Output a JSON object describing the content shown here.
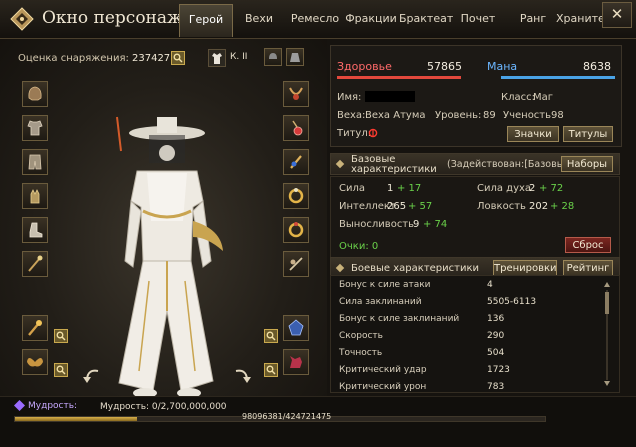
{
  "window": {
    "title": "Окно персонажа",
    "close_glyph": "✕"
  },
  "tabs": [
    {
      "label": "Герой",
      "active": true
    },
    {
      "label": "Вехи",
      "active": false
    },
    {
      "label": "Ремесло",
      "active": false
    },
    {
      "label": "Фракции",
      "active": false
    },
    {
      "label": "Брактеат",
      "active": false
    },
    {
      "label": "Почет",
      "active": false
    },
    {
      "label": "Ранг",
      "active": false
    },
    {
      "label": "Хранители",
      "active": false
    }
  ],
  "gear": {
    "label": "Оценка снаряжения:",
    "value": "237427",
    "rank_label": "К. II"
  },
  "equipment": {
    "left_slots": [
      "helmet-icon",
      "chest-armor-icon",
      "pants-icon",
      "gloves-icon",
      "boots-icon",
      "weapon-icon"
    ],
    "right_slots": [
      "necklace-icon",
      "earring-icon",
      "earring-icon",
      "ring-icon",
      "ring-icon",
      "bracelet-icon"
    ],
    "bottom_left_slots": [
      "staff-icon",
      "wings-icon"
    ],
    "bottom_right_slots": [
      "crest-icon",
      "pet-icon"
    ]
  },
  "stats": {
    "hp_label": "Здоровье",
    "hp_value": "57865",
    "mp_label": "Мана",
    "mp_value": "8638",
    "name_label": "Имя:",
    "class_label": "Класс:",
    "class_value": "Маг",
    "milestone_label": "Веха:",
    "milestone_value": "Веха Атума",
    "level_label": "Уровень:",
    "level_value": "89",
    "learning_label": "Ученость",
    "learning_value": "98",
    "title_label": "Титул:",
    "badges_button": "Значки",
    "titles_button": "Титулы",
    "colors": {
      "hp": "#e2483c",
      "mp": "#4aa3e6",
      "title_icon": "#ff3b30"
    }
  },
  "base": {
    "header_line1": "Базовые",
    "header_line2": "характеристики",
    "engaged_label": "(Задействован:[Базовы",
    "sets_button": "Наборы",
    "strength_label": "Сила",
    "strength_value": "1",
    "strength_bonus": "+ 17",
    "spirit_label": "Сила духа",
    "spirit_value": "2",
    "spirit_bonus": "+ 72",
    "intellect_label": "Интеллект",
    "intellect_value": "265",
    "intellect_bonus": "+ 57",
    "agility_label": "Ловкость",
    "agility_value": "202",
    "agility_bonus": "+ 28",
    "stamina_label": "Выносливость",
    "stamina_value": "9",
    "stamina_bonus": "+ 74",
    "points_label": "Очки: 0",
    "reset_button": "Сброс",
    "colors": {
      "bonus": "#6ad14a",
      "points": "#6ad14a"
    }
  },
  "battle": {
    "header": "Боевые характеристики",
    "training_button": "Тренировки",
    "rating_button": "Рейтинг",
    "rows": [
      {
        "label": "Бонус к силе атаки",
        "value": "4"
      },
      {
        "label": "Сила заклинаний",
        "value": "5505-6113"
      },
      {
        "label": "Бонус к силе заклинаний",
        "value": "136"
      },
      {
        "label": "Скорость",
        "value": "290"
      },
      {
        "label": "Точность",
        "value": "504"
      },
      {
        "label": "Критический удар",
        "value": "1723"
      },
      {
        "label": "Критический урон",
        "value": "783"
      }
    ]
  },
  "footer": {
    "wisdom_label": "Мудрость:",
    "wisdom_value": "Мудрость: 0/2,700,000,000",
    "xp_text": "98096381/424721475",
    "xp_fraction": 0.231
  }
}
